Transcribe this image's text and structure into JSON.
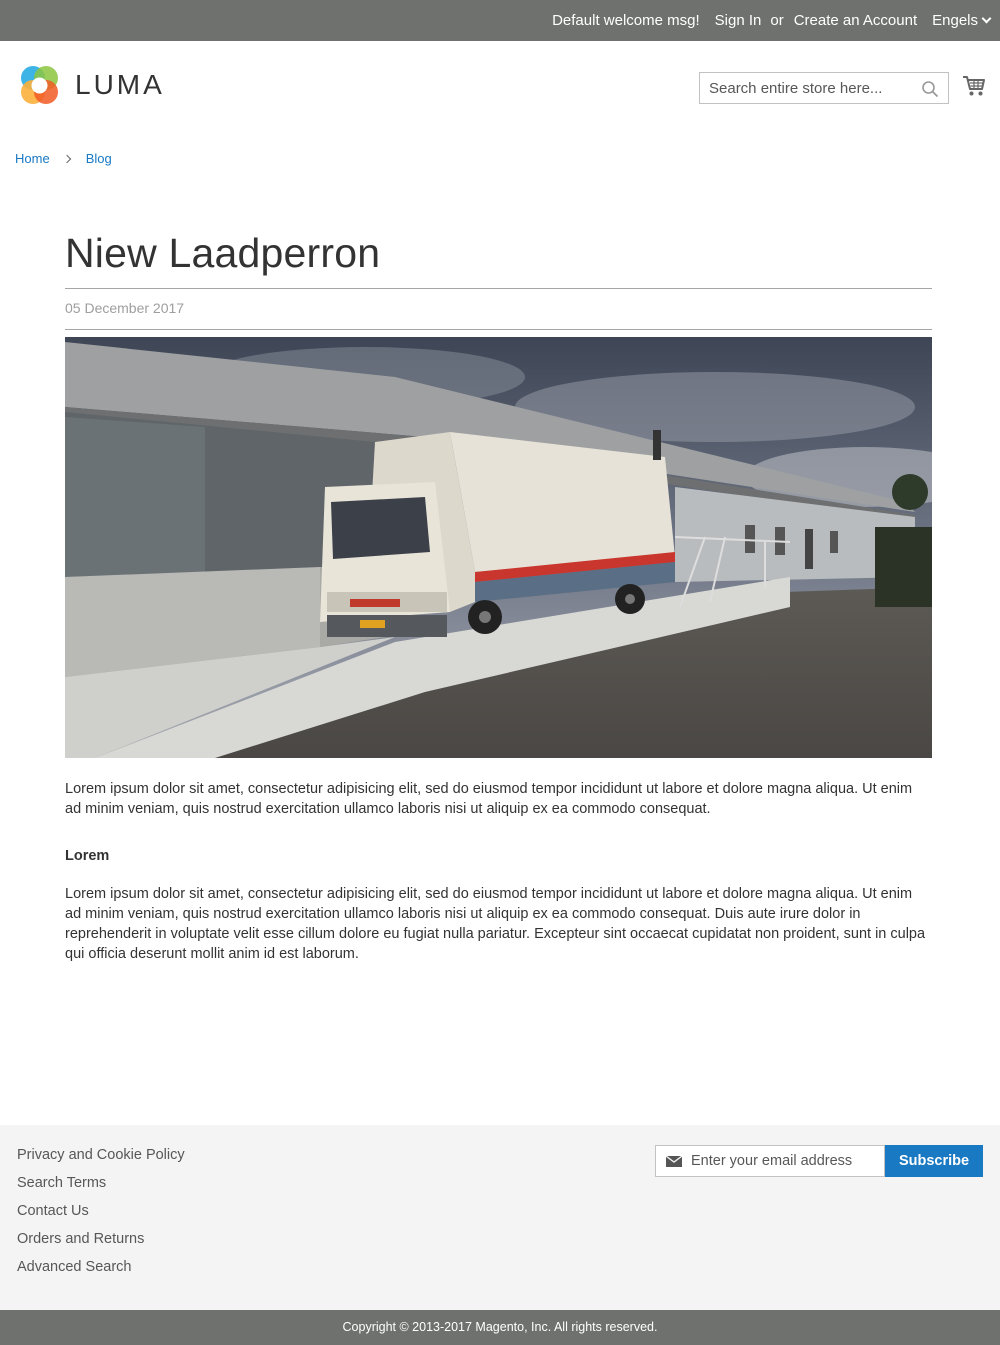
{
  "header": {
    "welcome": "Default welcome msg!",
    "sign_in": "Sign In",
    "or": "or",
    "create_account": "Create an Account",
    "language": "Engels",
    "logo_text": "LUMA",
    "search_placeholder": "Search entire store here...",
    "icons": [
      "chevron-down-icon",
      "luma-logo",
      "search-icon",
      "cart-icon"
    ]
  },
  "breadcrumbs": {
    "home": "Home",
    "blog": "Blog"
  },
  "post": {
    "title": "Niew Laadperron",
    "date": "05 December 2017",
    "image_alt": "truck at loading dock",
    "paragraph1": "Lorem ipsum dolor sit amet, consectetur adipisicing elit, sed do eiusmod tempor incididunt ut labore et dolore magna aliqua. Ut enim ad minim veniam, quis nostrud exercitation ullamco laboris nisi ut aliquip ex ea commodo consequat.",
    "subheading": "Lorem",
    "paragraph2": "Lorem ipsum dolor sit amet, consectetur adipisicing elit, sed do eiusmod tempor incididunt ut labore et dolore magna aliqua. Ut enim ad minim veniam, quis nostrud exercitation ullamco laboris nisi ut aliquip ex ea commodo consequat. Duis aute irure dolor in reprehenderit in voluptate velit esse cillum dolore eu fugiat nulla pariatur. Excepteur sint occaecat cupidatat non proident, sunt in culpa qui officia deserunt mollit anim id est laborum."
  },
  "footer": {
    "links": [
      "Privacy and Cookie Policy",
      "Search Terms",
      "Contact Us",
      "Orders and Returns",
      "Advanced Search"
    ],
    "newsletter_placeholder": "Enter your email address",
    "subscribe_label": "Subscribe",
    "copyright": "Copyright © 2013-2017 Magento, Inc. All rights reserved."
  },
  "colors": {
    "panel_bg": "#6e716e",
    "link": "#1979c3",
    "footer_bg": "#f4f4f4",
    "button": "#1979c3"
  }
}
